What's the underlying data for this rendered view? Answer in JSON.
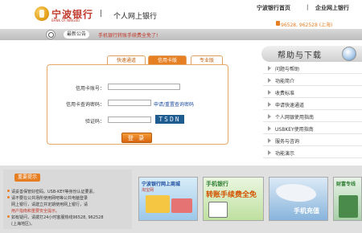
{
  "header": {
    "logo_cn": "宁波银行",
    "logo_en": "BANK OF NINGBO",
    "separator": "|",
    "title": "个人网上银行",
    "link_home": "宁波银行首页",
    "link_sep": "|",
    "link_corp": "企业网上银行",
    "hotline": "96528, 962528 (上海)"
  },
  "notice": {
    "label": "最新公告",
    "text": "手机银行转账手续费全免了!"
  },
  "tabs": [
    {
      "label": "快速通道"
    },
    {
      "label": "信用卡版"
    },
    {
      "label": "专业版"
    }
  ],
  "form": {
    "card_label": "信用卡账号：",
    "password_label": "信用卡查询密码：",
    "reset_link": "申请/重置查询密码",
    "captcha_label": "验证码：",
    "captcha_value": "TSDN",
    "login_label": "登 录"
  },
  "help": {
    "title": "帮助与下载",
    "items": [
      {
        "label": "问题与帮助"
      },
      {
        "label": "功能简介"
      },
      {
        "label": "收费标准"
      },
      {
        "label": "申请快速通道"
      },
      {
        "label": "个人网银使用指南"
      },
      {
        "label": "USBKEY使用指南"
      },
      {
        "label": "服务与咨询"
      },
      {
        "label": "功能演示"
      }
    ]
  },
  "tips": {
    "label": "重要提示",
    "lines": [
      "请妥善保管好密码。USB-KEY等身份认证要素。",
      "请不要在公共场所使用网吧等公共电脑登录",
      "网上银行，请建立并定期使用网上银行，请",
      "用户指南和重要安全提示。",
      "如有疑问，请拨打24小时客服热线96528, 962528",
      "(上海地区)。",
      ""
    ]
  },
  "banners": [
    {
      "title": "宁波银行网上商城",
      "sub": "淘宝网"
    },
    {
      "title": "手机银行",
      "sub": "转账手续费全免"
    },
    {
      "title": "手机充值",
      "sub": ""
    },
    {
      "title": "财富专线",
      "sub": ""
    }
  ],
  "colors": {
    "accent": "#e67e22",
    "brand_red": "#c0392b",
    "link_blue": "#1f4fa0"
  }
}
